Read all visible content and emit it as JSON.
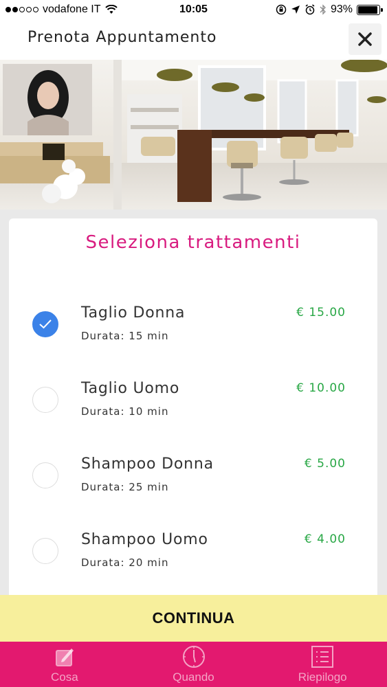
{
  "status_bar": {
    "carrier": "vodafone IT",
    "time": "10:05",
    "battery": "93%",
    "battery_level": 0.93
  },
  "header": {
    "title": "Prenota Appuntamento",
    "close_icon": "close-icon"
  },
  "card": {
    "title": "Seleziona trattamenti",
    "treatments": [
      {
        "name": "Taglio Donna",
        "duration": "Durata: 15 min",
        "price": "€ 15.00",
        "selected": true
      },
      {
        "name": "Taglio Uomo",
        "duration": "Durata: 10 min",
        "price": "€ 10.00",
        "selected": false
      },
      {
        "name": "Shampoo Donna",
        "duration": "Durata: 25 min",
        "price": "€ 5.00",
        "selected": false
      },
      {
        "name": "Shampoo Uomo",
        "duration": "Durata: 20 min",
        "price": "€ 4.00",
        "selected": false
      }
    ]
  },
  "continue_label": "CONTINUA",
  "tabs": [
    {
      "label": "Cosa",
      "icon": "edit-icon"
    },
    {
      "label": "Quando",
      "icon": "clock-icon"
    },
    {
      "label": "Riepilogo",
      "icon": "list-icon"
    }
  ],
  "colors": {
    "accent": "#d81b7f",
    "tabbar": "#e3196f",
    "price": "#28a745",
    "checked": "#3b82e8",
    "continue_bg": "#f7ef9c"
  }
}
